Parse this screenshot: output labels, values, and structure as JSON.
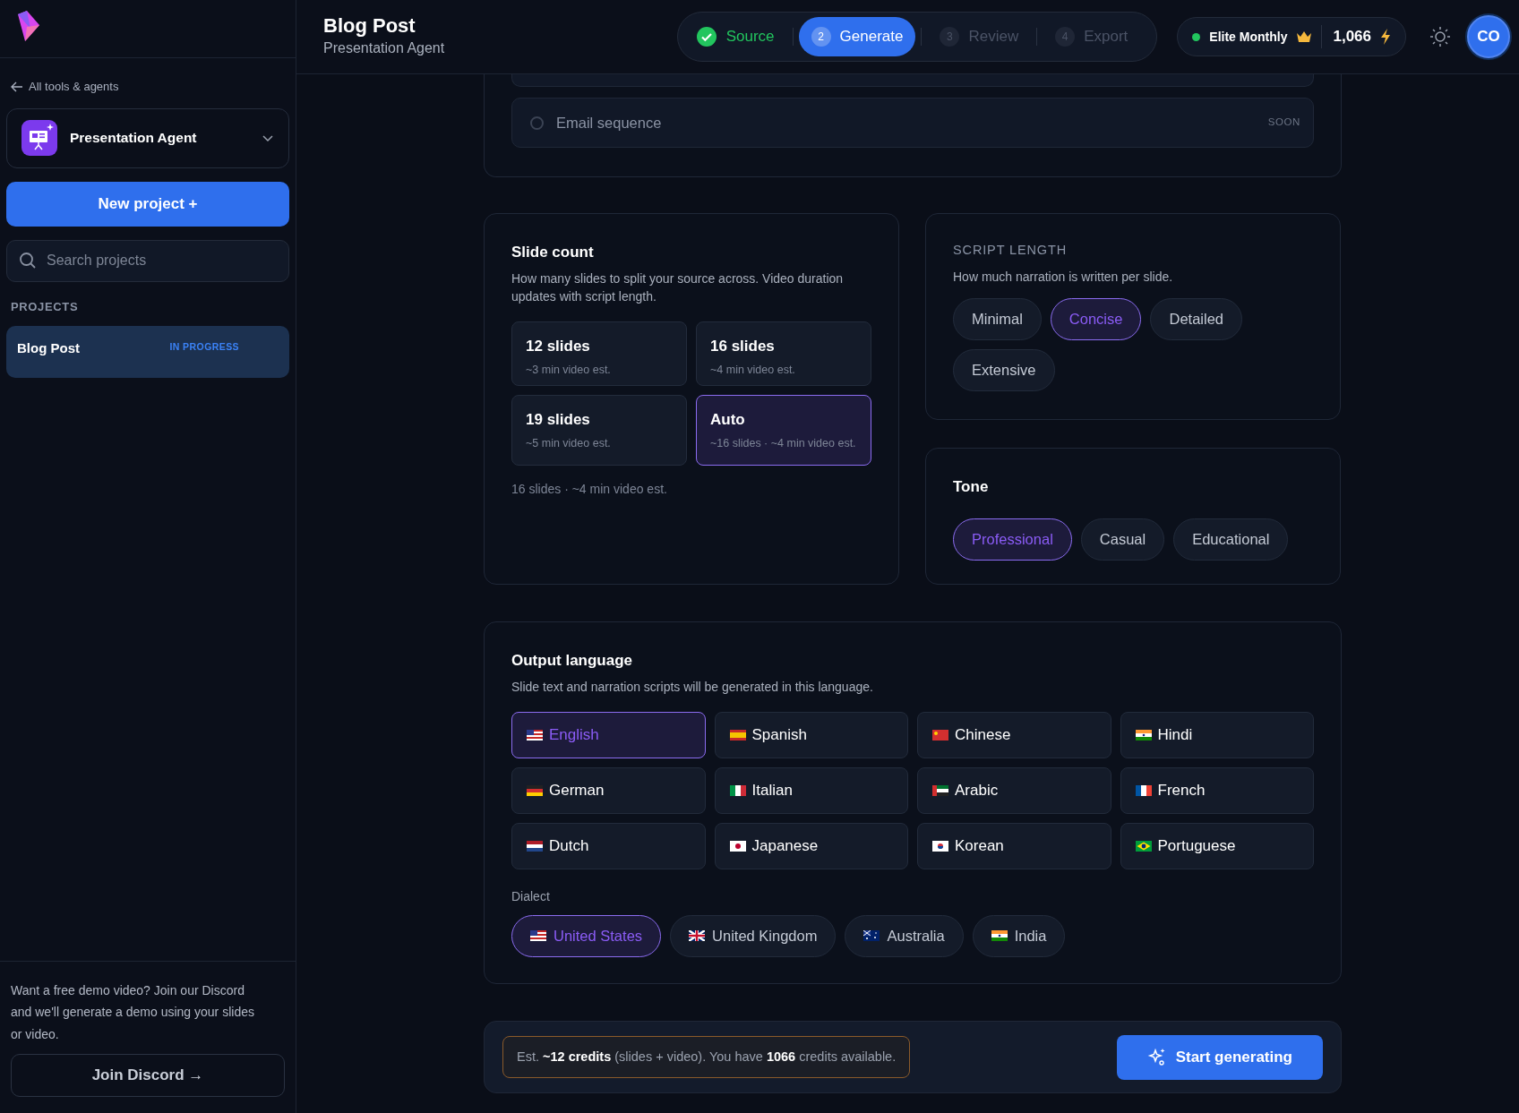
{
  "header": {
    "title": "Blog Post",
    "subtitle": "Presentation Agent"
  },
  "steps": [
    {
      "label": "Source",
      "completed": true,
      "selected": false
    },
    {
      "number": "2",
      "label": "Generate",
      "completed": false,
      "selected": true
    },
    {
      "number": "3",
      "label": "Review",
      "completed": false,
      "selected": false
    },
    {
      "number": "4",
      "label": "Export",
      "completed": false,
      "selected": false
    }
  ],
  "plan": {
    "name": "Elite Monthly",
    "credits": "1,066"
  },
  "avatar": "CO",
  "sidebar": {
    "back_link": "All tools & agents",
    "agent": "Presentation Agent",
    "new_button": "New project +",
    "search": {
      "placeholder": "Search projects"
    },
    "section": "PROJECTS",
    "projects": [
      {
        "name": "Blog Post",
        "status": "IN PROGRESS",
        "selected": true
      }
    ],
    "promo": "Want a free demo video? Join our Discord and we'll generate a demo using your slides or video.",
    "discord_button": "Join Discord →"
  },
  "format_options": [
    {
      "label": "Email sequence",
      "badge": "SOON",
      "disabled": true
    }
  ],
  "slide_count": {
    "title": "Slide count",
    "description": "How many slides to split your source across. Video duration updates with script length.",
    "options": [
      {
        "title": "12 slides",
        "subtitle": "~3 min video est.",
        "selected": false
      },
      {
        "title": "16 slides",
        "subtitle": "~4 min video est.",
        "selected": false
      },
      {
        "title": "19 slides",
        "subtitle": "~5 min video est.",
        "selected": false
      },
      {
        "title": "Auto",
        "subtitle": "~16 slides · ~4 min video est.",
        "selected": true
      }
    ],
    "summary": "16 slides · ~4 min video est."
  },
  "script_length": {
    "title": "SCRIPT LENGTH",
    "description": "How much narration is written per slide.",
    "options": [
      {
        "label": "Minimal",
        "selected": false
      },
      {
        "label": "Concise",
        "selected": true
      },
      {
        "label": "Detailed",
        "selected": false
      },
      {
        "label": "Extensive",
        "selected": false
      }
    ]
  },
  "tone": {
    "title": "Tone",
    "options": [
      {
        "label": "Professional",
        "selected": true
      },
      {
        "label": "Casual",
        "selected": false
      },
      {
        "label": "Educational",
        "selected": false
      }
    ]
  },
  "output_language": {
    "title": "Output language",
    "description": "Slide text and narration scripts will be generated in this language.",
    "languages": [
      {
        "label": "English",
        "kind": "us",
        "selected": true
      },
      {
        "label": "Spanish",
        "kind": "es",
        "selected": false
      },
      {
        "label": "Chinese",
        "kind": "cn",
        "selected": false
      },
      {
        "label": "Hindi",
        "kind": "in",
        "selected": false
      },
      {
        "label": "German",
        "kind": "de",
        "selected": false
      },
      {
        "label": "Italian",
        "kind": "it",
        "selected": false
      },
      {
        "label": "Arabic",
        "kind": "ae",
        "selected": false
      },
      {
        "label": "French",
        "kind": "fr",
        "selected": false
      },
      {
        "label": "Dutch",
        "kind": "nl",
        "selected": false
      },
      {
        "label": "Japanese",
        "kind": "jp",
        "selected": false
      },
      {
        "label": "Korean",
        "kind": "kr",
        "selected": false
      },
      {
        "label": "Portuguese",
        "kind": "br",
        "selected": false
      }
    ],
    "dialect_label": "Dialect",
    "dialects": [
      {
        "label": "United States",
        "kind": "us",
        "selected": true
      },
      {
        "label": "United Kingdom",
        "kind": "gb",
        "selected": false
      },
      {
        "label": "Australia",
        "kind": "au",
        "selected": false
      },
      {
        "label": "India",
        "kind": "in",
        "selected": false
      }
    ]
  },
  "footer": {
    "estimate": "Est. **~12 credits** (slides + video). You have **1066** credits available.",
    "button": "Start generating"
  }
}
